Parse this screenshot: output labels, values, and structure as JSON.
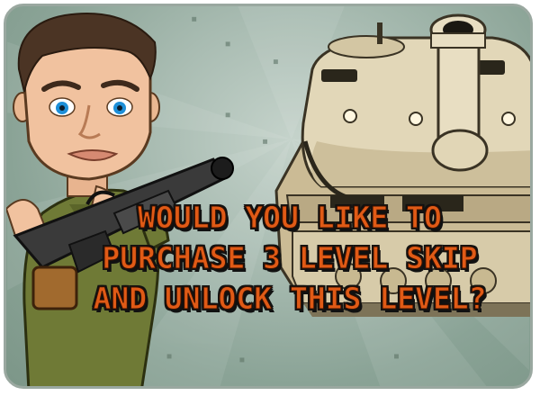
{
  "dialog": {
    "lines": [
      "WOULD YOU LIKE TO",
      "PURCHASE 3 LEVEL SKIP",
      "AND UNLOCK THIS LEVEL?"
    ]
  },
  "colors": {
    "text": "#e05a16",
    "text_outline": "#111111",
    "background": "#a9bcb2",
    "frame_border": "#9aa8a0",
    "tank": "#d9ccaa",
    "uniform": "#6f7a36"
  },
  "icons": {
    "soldier": "soldier-character",
    "tank": "tank",
    "gun": "minigun"
  }
}
